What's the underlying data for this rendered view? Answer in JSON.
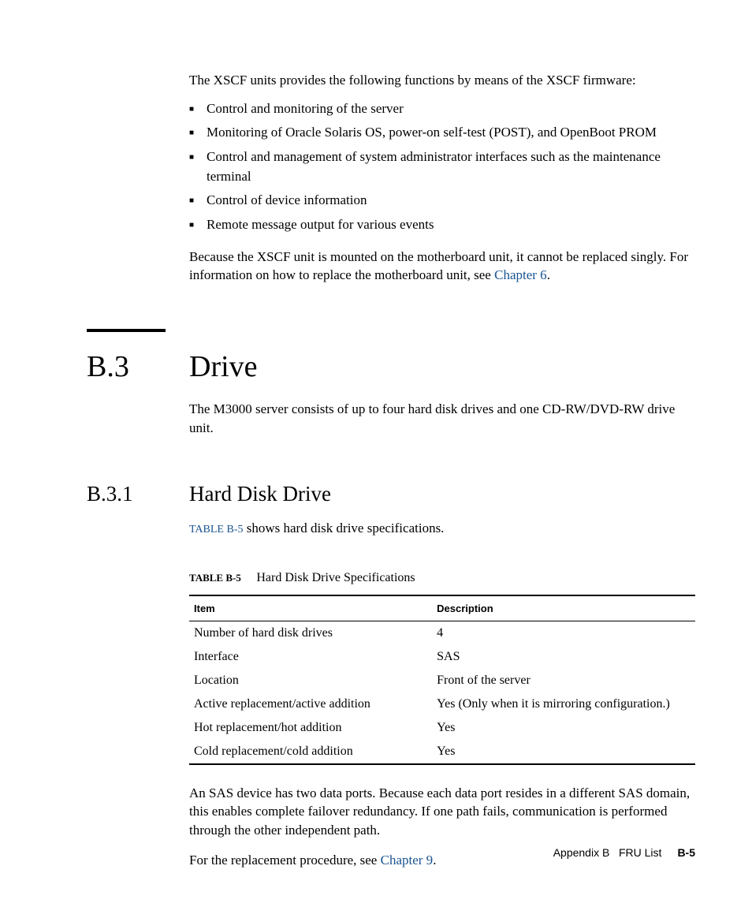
{
  "intro": {
    "lead": "The XSCF units provides the following functions by means of the XSCF firmware:",
    "bullets": [
      "Control and monitoring of the server",
      "Monitoring of Oracle Solaris OS, power-on self-test (POST), and OpenBoot PROM",
      "Control and management of system administrator interfaces such as the maintenance terminal",
      "Control of device information",
      "Remote message output for various events"
    ],
    "after_para_prefix": "Because the XSCF unit is mounted on the motherboard unit, it cannot be replaced singly. For information on how to replace the motherboard unit, see ",
    "after_link": "Chapter 6",
    "after_para_suffix": "."
  },
  "section": {
    "num": "B.3",
    "title": "Drive",
    "para": "The M3000 server consists of up to four hard disk drives and one CD-RW/DVD-RW drive unit."
  },
  "subsection": {
    "num": "B.3.1",
    "title": "Hard Disk Drive",
    "ref_link": "TABLE B-5",
    "ref_text": " shows hard disk drive specifications."
  },
  "table": {
    "caption_label": "TABLE B-5",
    "caption_text": "Hard Disk Drive Specifications",
    "headers": [
      "Item",
      "Description"
    ],
    "rows": [
      [
        "Number of hard disk drives",
        "4"
      ],
      [
        "Interface",
        "SAS"
      ],
      [
        "Location",
        "Front of the server"
      ],
      [
        "Active replacement/active addition",
        "Yes (Only when it is mirroring configuration.)"
      ],
      [
        "Hot replacement/hot addition",
        "Yes"
      ],
      [
        "Cold replacement/cold addition",
        "Yes"
      ]
    ]
  },
  "after_table": {
    "p1": "An SAS device has two data ports. Because each data port resides in a different SAS domain, this enables complete failover redundancy. If one path fails, communication is performed through the other independent path.",
    "p2_prefix": "For the replacement procedure, see ",
    "p2_link": "Chapter 9",
    "p2_suffix": "."
  },
  "footer": {
    "appendix": "Appendix B",
    "title": "FRU List",
    "page": "B-5"
  }
}
